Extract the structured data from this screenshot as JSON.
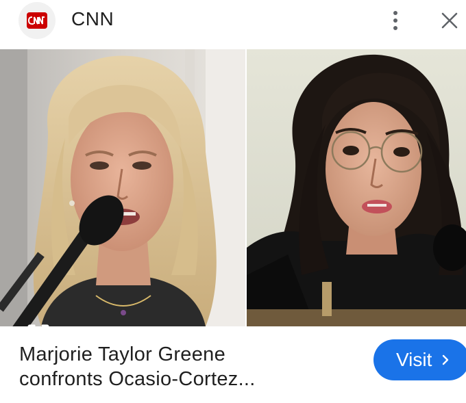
{
  "header": {
    "logo_text": "CNN",
    "source_name": "CNN",
    "more_icon": "more-vertical-icon",
    "close_icon": "close-icon"
  },
  "image": {
    "lens_icon": "google-lens-icon"
  },
  "footer": {
    "headline_line1": "Marjorie Taylor Greene",
    "headline_line2": "confronts Ocasio-Cortez...",
    "visit_label": "Visit",
    "visit_icon": "chevron-right-icon"
  },
  "colors": {
    "accent": "#1a73e8",
    "brand": "#cc0000"
  }
}
